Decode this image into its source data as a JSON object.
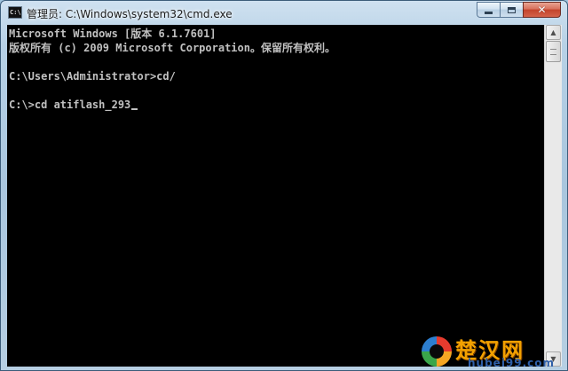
{
  "window": {
    "title": "管理员: C:\\Windows\\system32\\cmd.exe",
    "icon_label": "C:\\",
    "buttons": {
      "minimize": "minimize-icon",
      "maximize": "maximize-icon",
      "close": "✕"
    }
  },
  "console": {
    "lines": [
      "Microsoft Windows [版本 6.1.7601]",
      "版权所有 (c) 2009 Microsoft Corporation。保留所有权利。",
      "",
      "C:\\Users\\Administrator>cd/",
      "",
      "C:\\>cd atiflash_293"
    ],
    "cursor": "_"
  },
  "scrollbar": {
    "up_arrow": "▲",
    "down_arrow": "▼"
  },
  "watermark": {
    "title": "楚汉网",
    "url": "hubei99.com"
  }
}
